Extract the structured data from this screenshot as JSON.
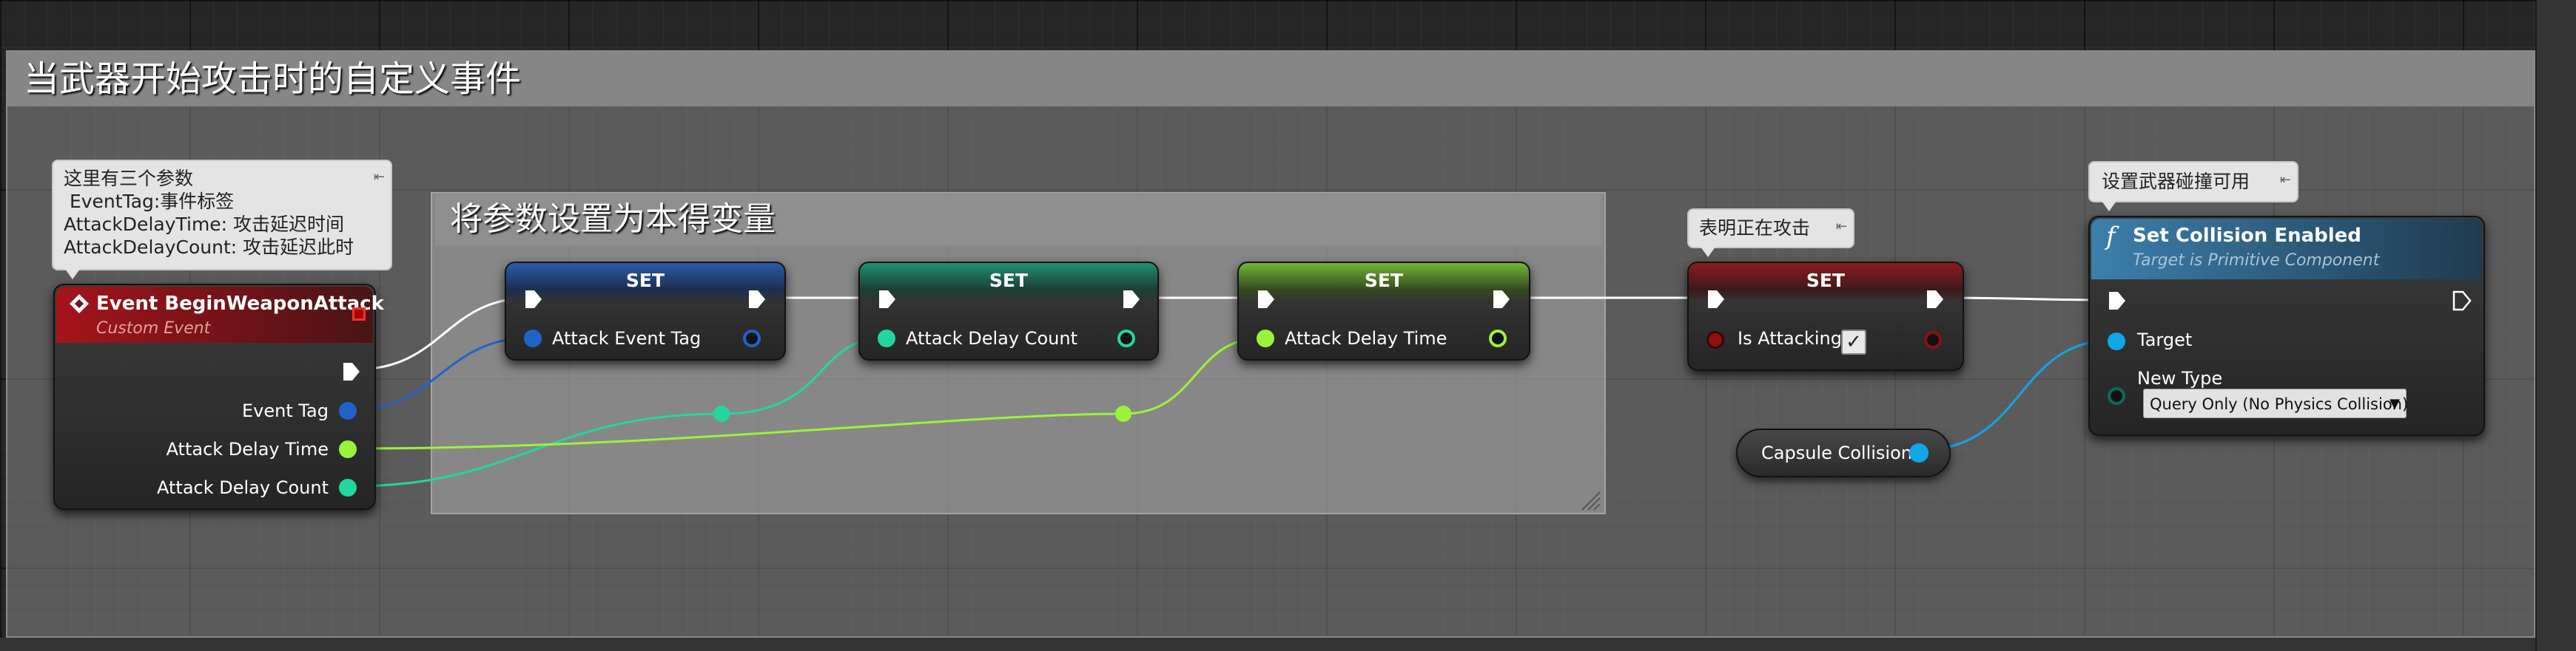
{
  "outer_comment": {
    "title": "当武器开始攻击时的自定义事件"
  },
  "inner_comment": {
    "title": "将参数设置为本得变量"
  },
  "notes": {
    "event": [
      "这里有三个参数",
      " EventTag:事件标签",
      "AttackDelayTime: 攻击延迟时间",
      "AttackDelayCount: 攻击延迟此时"
    ],
    "is_attacking": "表明正在攻击",
    "collision": "设置武器碰撞可用"
  },
  "event_node": {
    "title": "Event BeginWeaponAttack",
    "subtitle": "Custom Event",
    "outputs": [
      "Event Tag",
      "Attack Delay Time",
      "Attack Delay Count"
    ]
  },
  "set_nodes": [
    {
      "header": "SET",
      "pin": "Attack Event Tag"
    },
    {
      "header": "SET",
      "pin": "Attack Delay Count"
    },
    {
      "header": "SET",
      "pin": "Attack Delay Time"
    },
    {
      "header": "SET",
      "pin": "Is Attacking",
      "checked": true
    }
  ],
  "func_node": {
    "title": "Set Collision Enabled",
    "subtitle": "Target is Primitive Component",
    "pins": {
      "target": "Target",
      "new_type": "New Type"
    },
    "new_type_value": "Query Only (No Physics Collision)"
  },
  "capsule_node": {
    "label": "Capsule Collision"
  },
  "colors": {
    "exec": "#ffffff",
    "gameplay_tag": "#1f63c9",
    "float": "#9cf23a",
    "integer": "#23d6a0",
    "bool": "#8c1014",
    "object": "#10a6e8",
    "enum": "#0d6a5a",
    "event_header": "#a6141a",
    "function_header": "#3d7fad"
  },
  "icons": [
    "event-diamond-icon",
    "delegate-pin-icon",
    "function-icon",
    "pin-note-icon",
    "dropdown-caret-icon",
    "resize-grip-icon"
  ]
}
